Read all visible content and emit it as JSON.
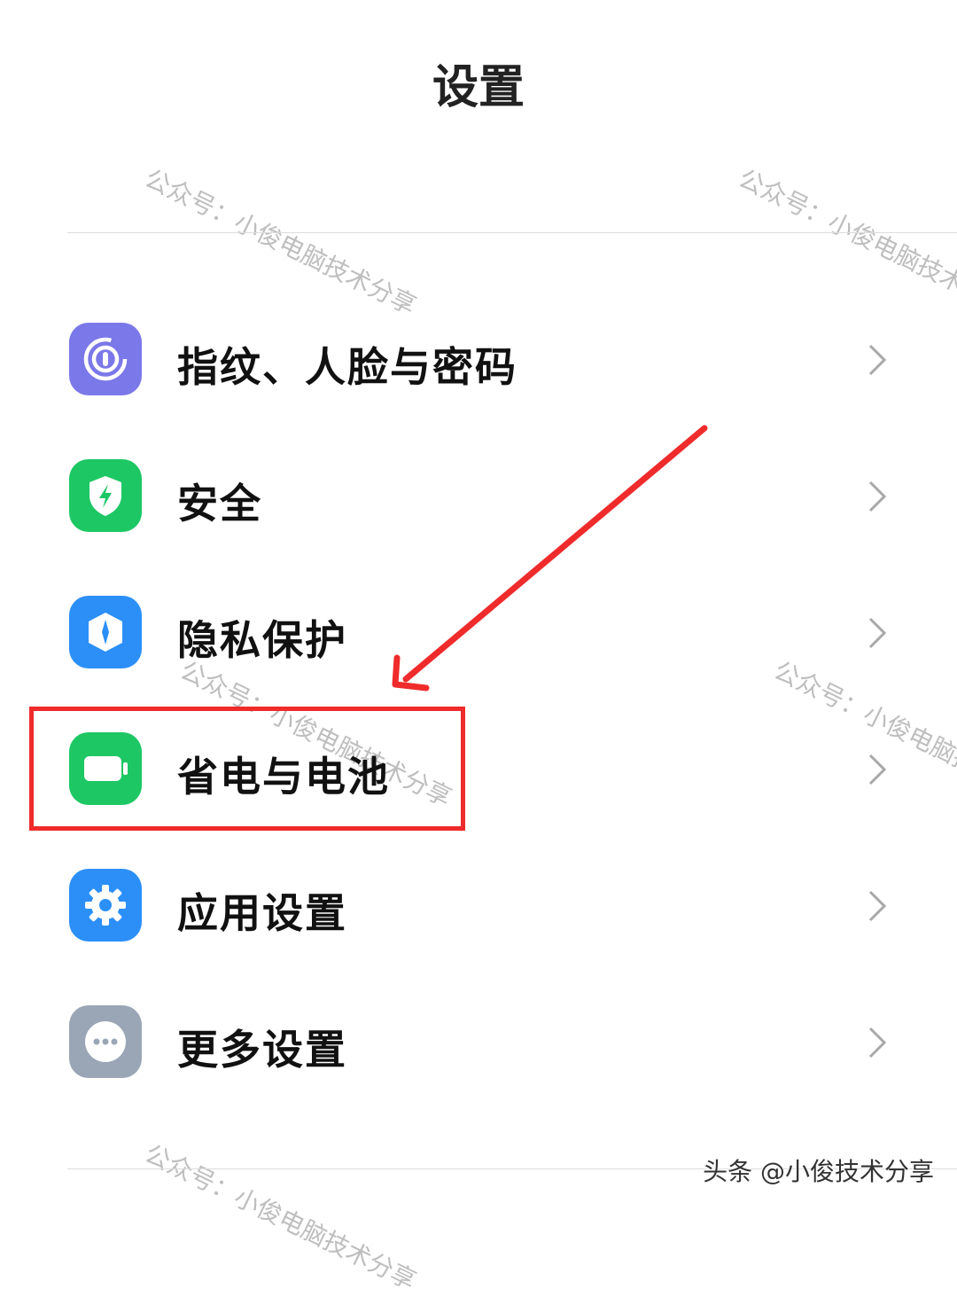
{
  "header": {
    "title": "设置"
  },
  "settings": {
    "items": [
      {
        "label": "指纹、人脸与密码",
        "icon": "fingerprint-icon",
        "color": "#7b78e9"
      },
      {
        "label": "安全",
        "icon": "shield-lightning-icon",
        "color": "#1dc764"
      },
      {
        "label": "隐私保护",
        "icon": "privacy-shield-icon",
        "color": "#2b8ff7"
      },
      {
        "label": "省电与电池",
        "icon": "battery-icon",
        "color": "#1dc764"
      },
      {
        "label": "应用设置",
        "icon": "gear-icon",
        "color": "#2b8ff7"
      },
      {
        "label": "更多设置",
        "icon": "more-dots-icon",
        "color": "#9aa6b6"
      }
    ]
  },
  "annotation": {
    "highlight_color": "#ef2b2b",
    "highlighted_item": "省电与电池"
  },
  "watermark": {
    "text": "公众号：小俊电脑技术分享",
    "footer": "头条 @小俊技术分享"
  }
}
